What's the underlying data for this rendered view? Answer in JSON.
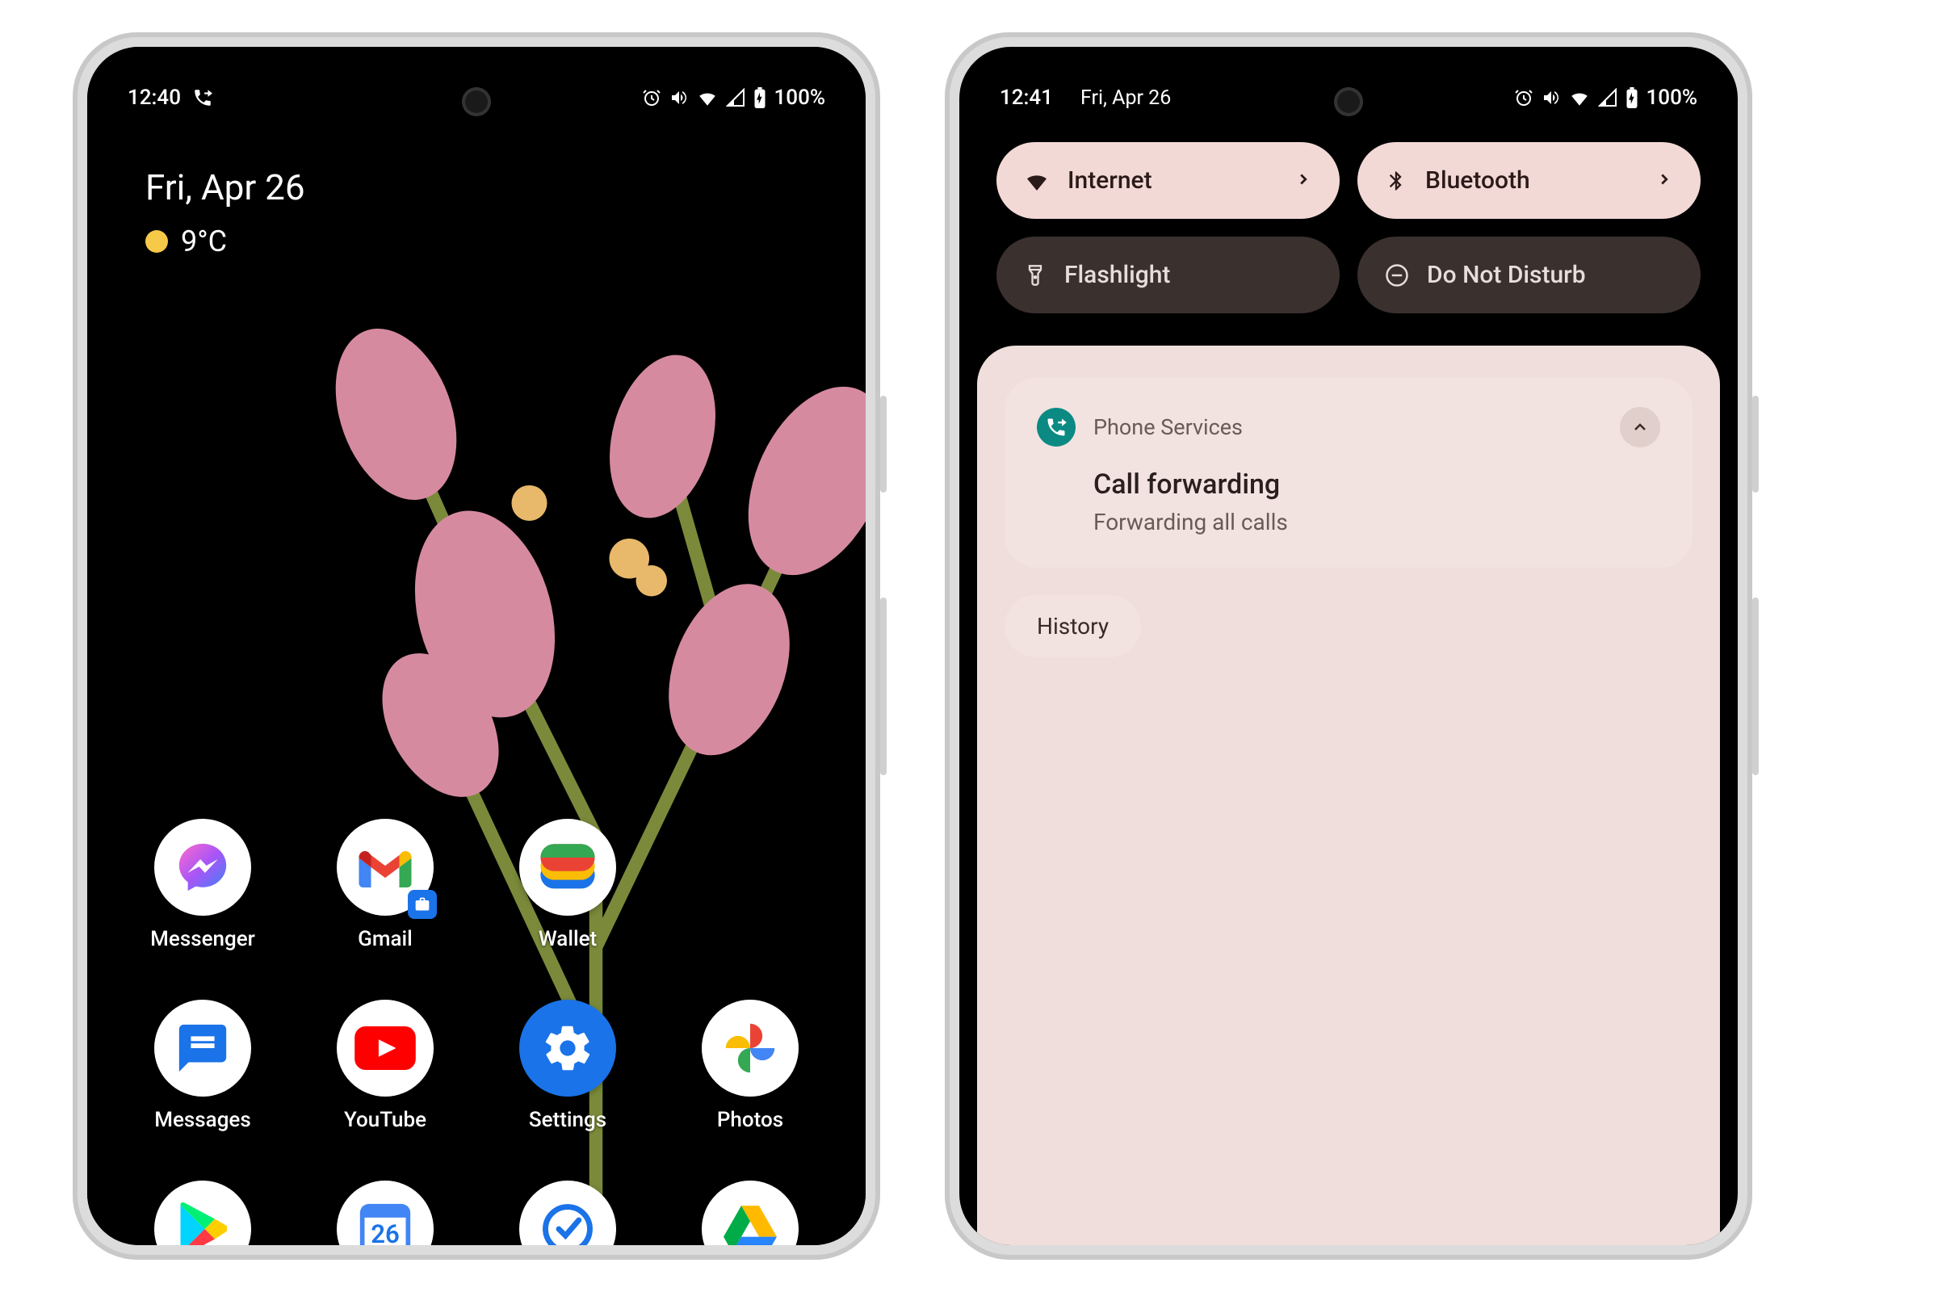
{
  "left": {
    "status": {
      "time": "12:40",
      "battery": "100%"
    },
    "date": "Fri, Apr 26",
    "weather": "9°C",
    "apps_row1": [
      {
        "label": "Messenger"
      },
      {
        "label": "Gmail"
      },
      {
        "label": "Wallet"
      },
      {
        "label": ""
      }
    ],
    "apps_row2": [
      {
        "label": "Messages"
      },
      {
        "label": "YouTube"
      },
      {
        "label": "Settings"
      },
      {
        "label": "Photos"
      }
    ],
    "apps_row3": [
      {
        "label": ""
      },
      {
        "label": "26"
      },
      {
        "label": ""
      },
      {
        "label": ""
      }
    ]
  },
  "right": {
    "status": {
      "time": "12:41",
      "date": "Fri, Apr 26",
      "battery": "100%"
    },
    "tiles": [
      {
        "label": "Internet",
        "state": "on",
        "icon": "wifi"
      },
      {
        "label": "Bluetooth",
        "state": "on",
        "icon": "bluetooth"
      },
      {
        "label": "Flashlight",
        "state": "off",
        "icon": "flashlight"
      },
      {
        "label": "Do Not Disturb",
        "state": "off",
        "icon": "dnd"
      }
    ],
    "notification": {
      "app": "Phone Services",
      "title": "Call forwarding",
      "body": "Forwarding all calls"
    },
    "history_label": "History"
  }
}
